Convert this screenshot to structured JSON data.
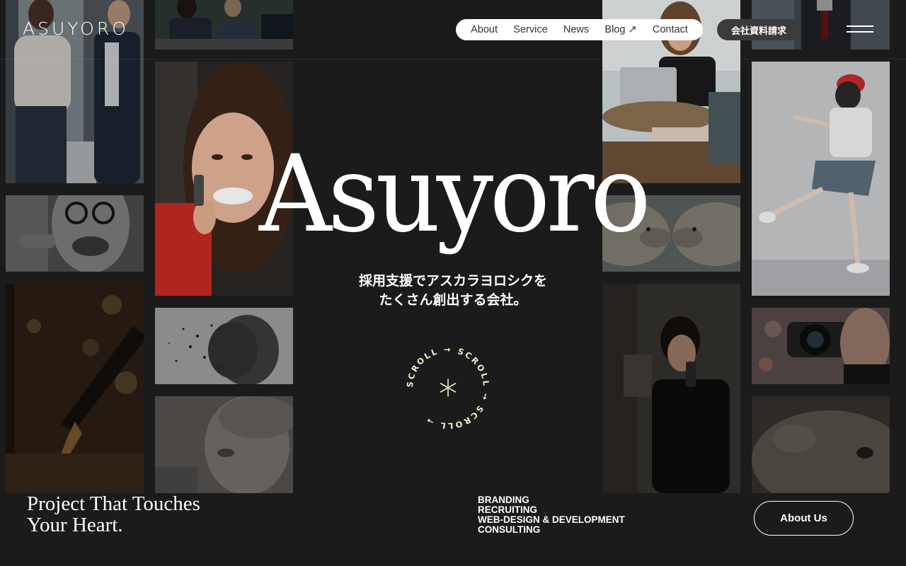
{
  "header": {
    "logo": "ASUYORO",
    "nav": [
      "About",
      "Service",
      "News",
      "Blog ↗",
      "Contact"
    ],
    "cta": "会社資料請求"
  },
  "hero": {
    "title": "Asuyoro",
    "subtitle_line1": "採用支援でアスカラヨロシクを",
    "subtitle_line2": "たくさん創出する会社。",
    "scroll_text": "SCROLL → SCROLL → SCROLL →"
  },
  "footer_band": {
    "tagline_line1": "Project That Touches",
    "tagline_line2": "Your Heart.",
    "services": [
      "BRANDING",
      "RECRUITING",
      "WEB-DESIGN & DEVELOPMENT",
      "CONSULTING"
    ],
    "about_button": "About Us"
  },
  "colors": {
    "background": "#1b1b1b",
    "scroll_ring": "#f2ecc9"
  },
  "icons": [
    "menu-icon",
    "asterisk-icon",
    "arrow-icon"
  ]
}
